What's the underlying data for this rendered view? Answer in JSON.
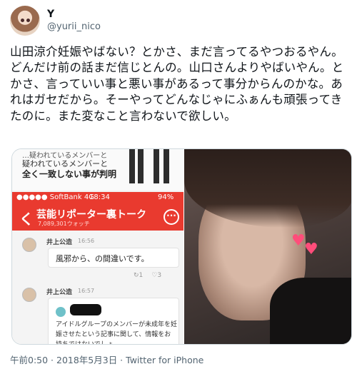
{
  "tweet": {
    "display_name": "Y",
    "handle": "@yurii_nico",
    "text": "山田涼介妊娠やばない？とかさ、まだ言ってるやつおるやん。どんだけ前の話まだ信じとんの。山口さんよりやばいやん。とかさ、言っていい事と悪い事があるって事分からんのかな。あれはガセだから。そーやってどんなじゃにふぁんも頑張ってきたのに。また変なこと言わないで欲しい。",
    "timestamp": "午前0:50 · 2018年5月3日 · Twitter for iPhone"
  },
  "media": {
    "left_image": {
      "snippet_line1": "…疑われているメンバーと",
      "snippet_line2": "疑われているメンバーと",
      "snippet_line3": "全く一致しない事が判明",
      "status_carrier": "●●●●● SoftBank  4G",
      "status_time": "18:34",
      "status_battery": "94%",
      "nav_back": "く",
      "nav_title": "芸能リポーター裏トーク",
      "nav_subtitle": "7,089,301ウォッチ",
      "nav_more": "···",
      "messages": [
        {
          "name": "井上公造",
          "time": "16:56",
          "text": "風邪から、の間違いです。",
          "reacts": [
            "↻1",
            "♡3"
          ]
        },
        {
          "name": "井上公造",
          "time": "16:57",
          "text": "アイドルグループのメンバーが未成年を妊娠させたという記事に関して、情報をお持ちではないでしょ"
        }
      ]
    },
    "right_image": {
      "hearts": "♥♥"
    }
  }
}
